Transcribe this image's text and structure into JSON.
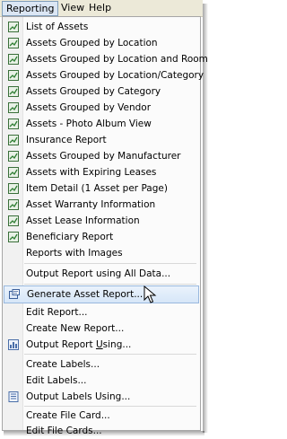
{
  "menubar": {
    "reporting": "Reporting",
    "view": "View",
    "help": "Help"
  },
  "menu": {
    "items": [
      {
        "label": "List of Assets",
        "icon": "report-icon"
      },
      {
        "label": "Assets Grouped by Location",
        "icon": "report-icon"
      },
      {
        "label": "Assets Grouped by Location and Room",
        "icon": "report-icon"
      },
      {
        "label": "Assets Grouped by Location/Category",
        "icon": "report-icon"
      },
      {
        "label": "Assets Grouped by Category",
        "icon": "report-icon"
      },
      {
        "label": "Assets Grouped by Vendor",
        "icon": "report-icon"
      },
      {
        "label": "Assets - Photo Album View",
        "icon": "report-icon"
      },
      {
        "label": "Insurance Report",
        "icon": "report-icon"
      },
      {
        "label": "Assets Grouped by Manufacturer",
        "icon": "report-icon"
      },
      {
        "label": "Assets with Expiring Leases",
        "icon": "report-icon"
      },
      {
        "label": "Item Detail (1 Asset per Page)",
        "icon": "report-icon"
      },
      {
        "label": "Asset Warranty Information",
        "icon": "report-icon"
      },
      {
        "label": "Asset Lease Information",
        "icon": "report-icon"
      },
      {
        "label": "Beneficiary Report",
        "icon": "report-icon"
      },
      {
        "label": "Reports with Images",
        "icon": ""
      },
      {
        "label": "Output Report using All Data...",
        "icon": ""
      },
      {
        "label": "Generate Asset Report...",
        "icon": "generate-report-icon"
      },
      {
        "label": "Edit Report...",
        "icon": ""
      },
      {
        "label": "Create New Report...",
        "icon": ""
      },
      {
        "label_pre": "Output Report ",
        "label_u": "U",
        "label_post": "sing...",
        "icon": "output-report-icon"
      },
      {
        "label": "Create Labels...",
        "icon": ""
      },
      {
        "label": "Edit Labels...",
        "icon": ""
      },
      {
        "label": "Output Labels Using...",
        "icon": "output-labels-icon"
      },
      {
        "label": "Create File Card...",
        "icon": ""
      },
      {
        "label": "Edit File Cards...",
        "icon": ""
      }
    ]
  },
  "colors": {
    "menubar_bg": "#ece9d8",
    "hover_bg": "#d6e6f8",
    "icon_green": "#2e7d32"
  }
}
